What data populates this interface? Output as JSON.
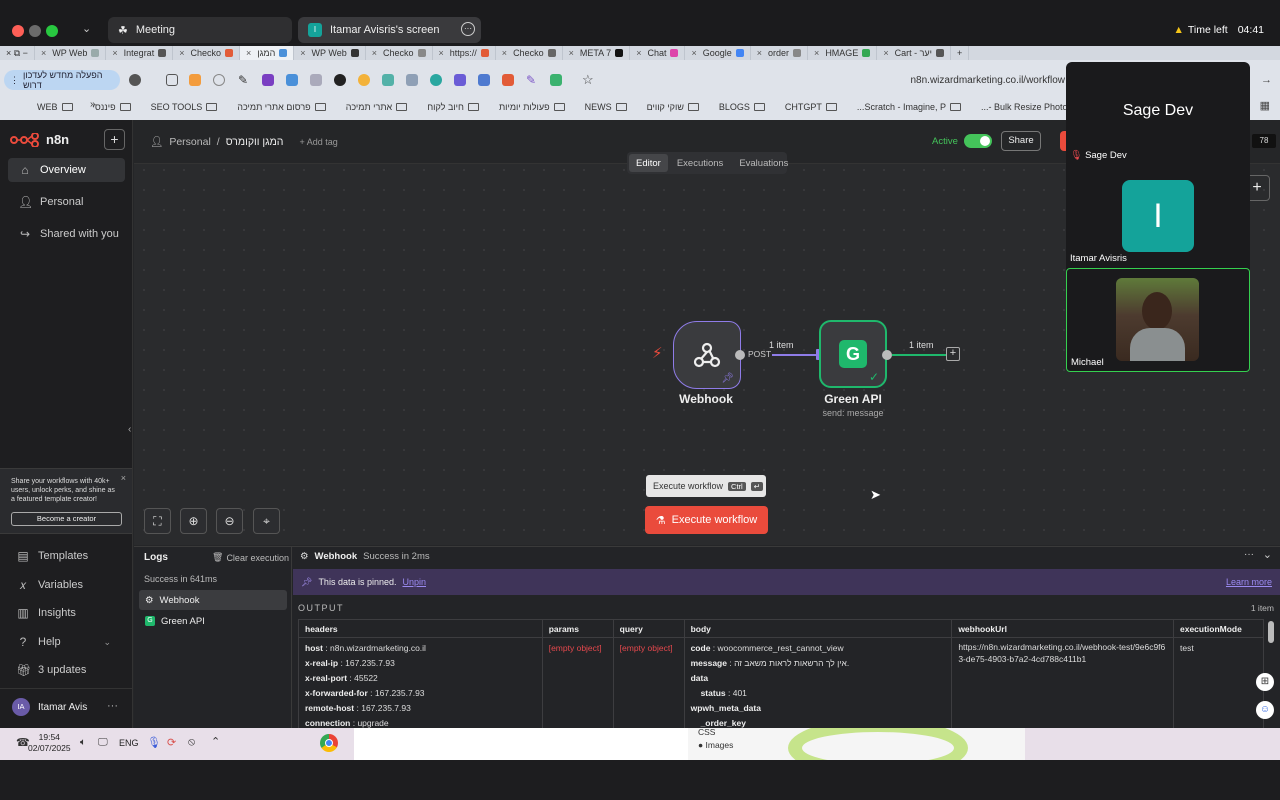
{
  "meeting": {
    "tab1": "Meeting",
    "tab2": "Itamar Avisris's screen",
    "tab2_avatar": "I",
    "time_left_label": "Time left",
    "time_left_value": "04:41"
  },
  "browser": {
    "tabs": [
      "WP Web",
      "Integrat",
      "Checko",
      "המגן",
      "WP Web",
      "Checko",
      "https://",
      "Checko",
      "META 7",
      "Chat",
      "Google",
      "order",
      "HMAGE",
      "Cart - יער"
    ],
    "hebrew_button": "הפעלה מחדש לעדכון דרוש",
    "url": "n8n.wizardmarketing.co.il/workflow",
    "bookmarks": [
      "כל הסימניות",
      "ארגז כלים",
      "Bulk Resize Photos -...",
      "Scratch - Imagine, P...",
      "CHTGPT",
      "BLOGS",
      "שוקי קווים",
      "NEWS",
      "פעולות יומיות",
      "חיוב לקוח",
      "אתרי תמיכה",
      "פרסום אתרי תמיכה",
      "SEO TOOLS",
      "פיננסי",
      "WEB"
    ]
  },
  "sidebar": {
    "brand": "n8n",
    "items": [
      "Overview",
      "Personal",
      "Shared with you"
    ],
    "promo_text": "Share your workflows with 40k+ users, unlock perks, and shine as a featured template creator!",
    "promo_button": "Become a creator",
    "bottom_items": [
      "Templates",
      "Variables",
      "Insights",
      "Help",
      "3 updates"
    ],
    "user_initials": "IA",
    "user_name": "Itamar Avis"
  },
  "topbar": {
    "breadcrumb_project": "Personal",
    "breadcrumb_sep": "/",
    "workflow_name": "המגן ווקומרס",
    "add_tag": "+ Add tag",
    "active_label": "Active",
    "share_label": "Share",
    "badge": "78",
    "tabs": [
      "Editor",
      "Executions",
      "Evaluations"
    ]
  },
  "canvas": {
    "node1_label": "Webhook",
    "node2_label": "Green API",
    "node2_sub": "send: message",
    "edge1_label": "1 item",
    "edge1_port": "POST",
    "edge2_label": "1 item",
    "tooltip_label": "Execute workflow",
    "tooltip_key1": "Ctrl",
    "tooltip_key2": "↵",
    "execute_button": "Execute workflow"
  },
  "logs": {
    "title": "Logs",
    "clear": "Clear execution",
    "status": "Success in 641ms",
    "entries": [
      "Webhook",
      "Green API"
    ],
    "node_title": "Webhook",
    "node_status": "Success in 2ms",
    "pinned_msg": "This data is pinned.",
    "unpin": "Unpin",
    "learn_more": "Learn more",
    "output_label": "OUTPUT",
    "item_count": "1 item",
    "columns": [
      "headers",
      "params",
      "query",
      "body",
      "webhookUrl",
      "executionMode"
    ],
    "headers_rows": [
      {
        "k": "host",
        "v": "n8n.wizardmarketing.co.il"
      },
      {
        "k": "x-real-ip",
        "v": "167.235.7.93"
      },
      {
        "k": "x-real-port",
        "v": "45522"
      },
      {
        "k": "x-forwarded-for",
        "v": "167.235.7.93"
      },
      {
        "k": "remote-host",
        "v": "167.235.7.93"
      },
      {
        "k": "connection",
        "v": "upgrade"
      }
    ],
    "params_value": "[empty object]",
    "query_value": "[empty object]",
    "body_code_k": "code",
    "body_code_v": "woocommerce_rest_cannot_view",
    "body_msg_k": "message",
    "body_msg_v": "אין לך הרשאות לראות משאב זה.",
    "body_data": "data",
    "body_status_k": "status",
    "body_status_v": "401",
    "body_meta": "wpwh_meta_data",
    "body_order_key": "_order_key",
    "body_css": "CSS",
    "body_images": "Images",
    "webhook_url": "https://n8n.wizardmarketing.co.il/webhook-test/9e6c9f63-de75-4903-b7a2-4cd788c411b1",
    "execution_mode": "test"
  },
  "video": {
    "presenter": "Sage Dev",
    "p1_name": "Sage Dev",
    "p2_initial": "I",
    "p2_name": "Itamar Avisris",
    "p3_name": "Michael"
  },
  "taskbar": {
    "time": "19:54",
    "date": "02/07/2025",
    "lang": "ENG"
  },
  "colors": {
    "accent": "#ea4b3c",
    "green_api": "#1fb86c",
    "active_toggle": "#44c35a",
    "pinned_bg": "#3f3459",
    "webhook_border": "#8f7ce8"
  }
}
